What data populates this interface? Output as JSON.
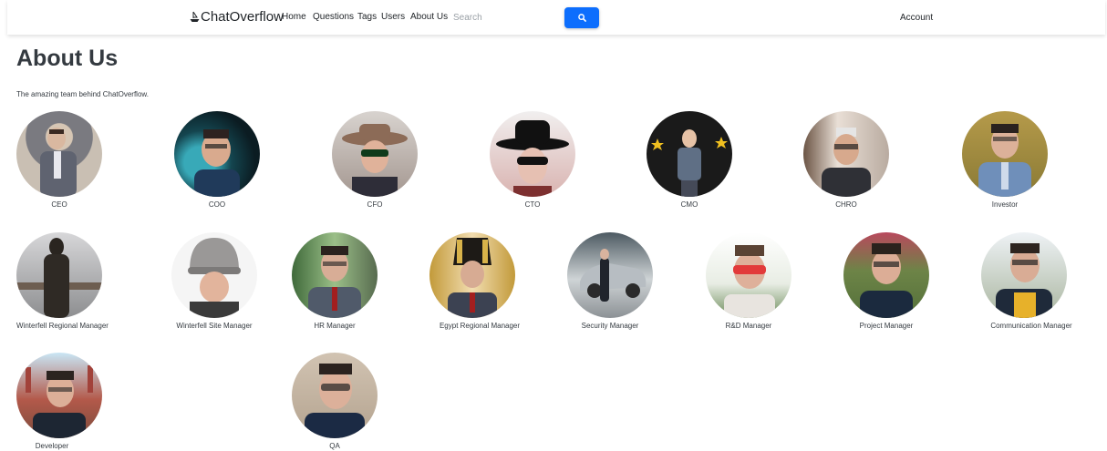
{
  "nav": {
    "brand": "ChatOverflow",
    "links": [
      "Home",
      "Questions",
      "Tags",
      "Users",
      "About Us"
    ],
    "search_placeholder": "Search",
    "account": "Account"
  },
  "page": {
    "title": "About Us",
    "subtitle": "The amazing team behind ChatOverflow."
  },
  "team": [
    {
      "role": "CEO"
    },
    {
      "role": "COO"
    },
    {
      "role": "CFO"
    },
    {
      "role": "CTO"
    },
    {
      "role": "CMO"
    },
    {
      "role": "CHRO"
    },
    {
      "role": "Investor"
    },
    {
      "role": "Winterfell Regional Manager"
    },
    {
      "role": "Winterfell Site Manager"
    },
    {
      "role": "HR Manager"
    },
    {
      "role": "Egypt Regional Manager"
    },
    {
      "role": "Security Manager"
    },
    {
      "role": "R&D Manager"
    },
    {
      "role": "Project Manager"
    },
    {
      "role": "Communication Manager"
    },
    {
      "role": "Developer"
    },
    {
      "role": "QA"
    }
  ],
  "colors": {
    "primary": "#0d6efd",
    "text": "#212529",
    "heading": "#343a40"
  },
  "icons": {
    "brand": "ship-icon",
    "search": "search-icon"
  }
}
